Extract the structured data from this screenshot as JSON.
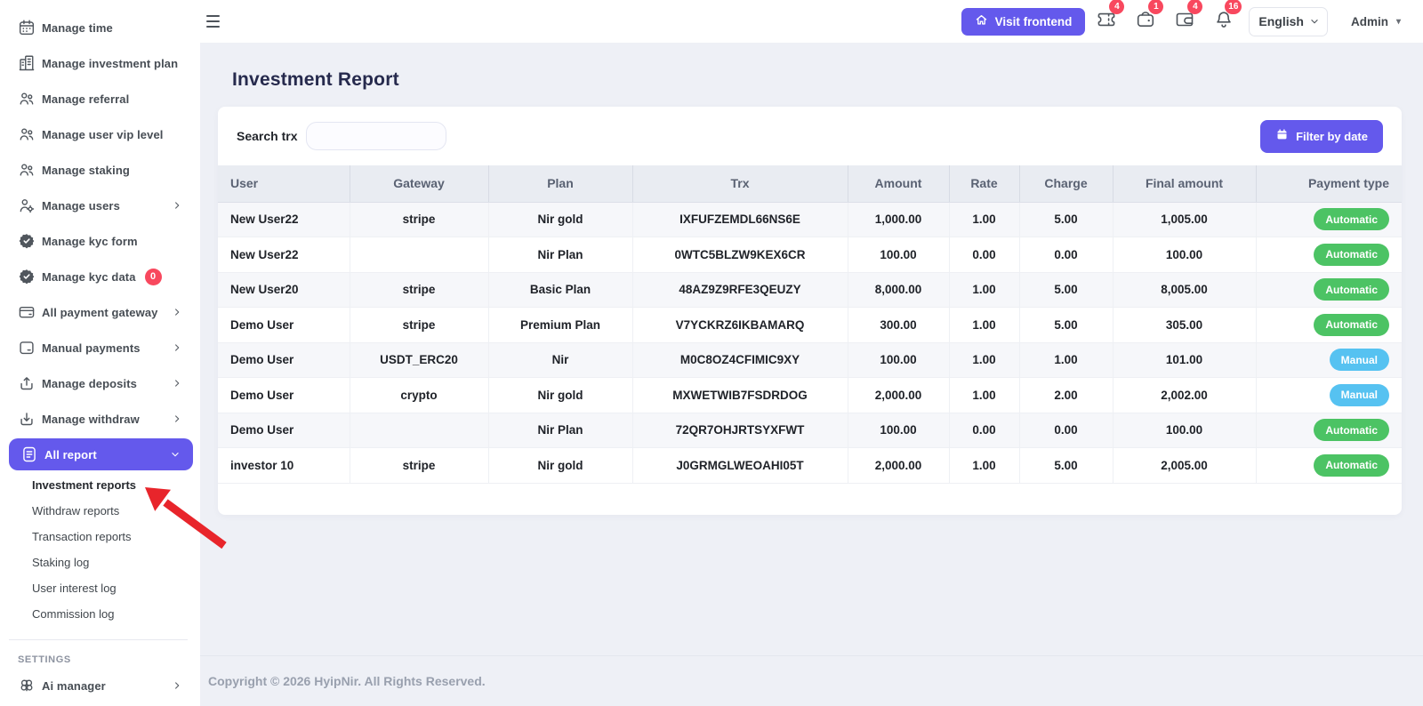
{
  "accent": "#6459ec",
  "colors": {
    "green": "#4cc364",
    "blue": "#56c2f1",
    "red": "#f8485e"
  },
  "sidebar": {
    "items": [
      {
        "icon": "calendar-icon",
        "label": "Manage time"
      },
      {
        "icon": "building-icon",
        "label": "Manage investment plan"
      },
      {
        "icon": "users-icon",
        "label": "Manage referral"
      },
      {
        "icon": "users-icon",
        "label": "Manage user vip level"
      },
      {
        "icon": "users-icon",
        "label": "Manage staking"
      },
      {
        "icon": "user-gear-icon",
        "label": "Manage users",
        "chevron": "right"
      },
      {
        "icon": "badge-check-icon",
        "label": "Manage kyc form"
      },
      {
        "icon": "badge-check-icon",
        "label": "Manage kyc data",
        "badge": "0"
      },
      {
        "icon": "credit-card-icon",
        "label": "All payment gateway",
        "chevron": "right"
      },
      {
        "icon": "card-icon",
        "label": "Manual payments",
        "chevron": "right"
      },
      {
        "icon": "deposit-icon",
        "label": "Manage deposits",
        "chevron": "right"
      },
      {
        "icon": "withdraw-icon",
        "label": "Manage withdraw",
        "chevron": "right"
      },
      {
        "icon": "file-lines-icon",
        "label": "All report",
        "chevron": "down",
        "active": true
      }
    ],
    "submenu": [
      {
        "label": "Investment reports",
        "active": true
      },
      {
        "label": "Withdraw reports"
      },
      {
        "label": "Transaction reports"
      },
      {
        "label": "Staking log"
      },
      {
        "label": "User interest log"
      },
      {
        "label": "Commission log"
      }
    ],
    "section_label": "SETTINGS",
    "settings_items": [
      {
        "icon": "brain-icon",
        "label": "Ai manager",
        "chevron": "right"
      }
    ]
  },
  "topbar": {
    "visit_frontend": "Visit frontend",
    "notifications": [
      {
        "icon": "ticket-icon",
        "count": "4"
      },
      {
        "icon": "purse-icon",
        "count": "1"
      },
      {
        "icon": "wallet-icon",
        "count": "4"
      },
      {
        "icon": "bell-icon",
        "count": "16"
      }
    ],
    "language": "English",
    "user": "Admin"
  },
  "page": {
    "title": "Investment Report"
  },
  "filters": {
    "search_label": "Search trx",
    "search_value": "",
    "filter_button": "Filter by date"
  },
  "table": {
    "columns": [
      "User",
      "Gateway",
      "Plan",
      "Trx",
      "Amount",
      "Rate",
      "Charge",
      "Final amount",
      "Payment type"
    ],
    "rows": [
      {
        "user": "New User22",
        "gateway": "stripe",
        "plan": "Nir gold",
        "trx": "IXFUFZEMDL66NS6E",
        "amount": "1,000.00",
        "rate": "1.00",
        "charge": "5.00",
        "final": "1,005.00",
        "payment_type": "Automatic"
      },
      {
        "user": "New User22",
        "gateway": "",
        "plan": "Nir Plan",
        "trx": "0WTC5BLZW9KEX6CR",
        "amount": "100.00",
        "rate": "0.00",
        "charge": "0.00",
        "final": "100.00",
        "payment_type": "Automatic"
      },
      {
        "user": "New User20",
        "gateway": "stripe",
        "plan": "Basic Plan",
        "trx": "48AZ9Z9RFE3QEUZY",
        "amount": "8,000.00",
        "rate": "1.00",
        "charge": "5.00",
        "final": "8,005.00",
        "payment_type": "Automatic"
      },
      {
        "user": "Demo User",
        "gateway": "stripe",
        "plan": "Premium Plan",
        "trx": "V7YCKRZ6IKBAMARQ",
        "amount": "300.00",
        "rate": "1.00",
        "charge": "5.00",
        "final": "305.00",
        "payment_type": "Automatic"
      },
      {
        "user": "Demo User",
        "gateway": "USDT_ERC20",
        "plan": "Nir",
        "trx": "M0C8OZ4CFIMIC9XY",
        "amount": "100.00",
        "rate": "1.00",
        "charge": "1.00",
        "final": "101.00",
        "payment_type": "Manual"
      },
      {
        "user": "Demo User",
        "gateway": "crypto",
        "plan": "Nir gold",
        "trx": "MXWETWIB7FSDRDOG",
        "amount": "2,000.00",
        "rate": "1.00",
        "charge": "2.00",
        "final": "2,002.00",
        "payment_type": "Manual"
      },
      {
        "user": "Demo User",
        "gateway": "",
        "plan": "Nir Plan",
        "trx": "72QR7OHJRTSYXFWT",
        "amount": "100.00",
        "rate": "0.00",
        "charge": "0.00",
        "final": "100.00",
        "payment_type": "Automatic"
      },
      {
        "user": "investor 10",
        "gateway": "stripe",
        "plan": "Nir gold",
        "trx": "J0GRMGLWEOAHI05T",
        "amount": "2,000.00",
        "rate": "1.00",
        "charge": "5.00",
        "final": "2,005.00",
        "payment_type": "Automatic"
      }
    ]
  },
  "footer": {
    "copyright": "Copyright © 2026 HyipNir. All Rights Reserved."
  }
}
